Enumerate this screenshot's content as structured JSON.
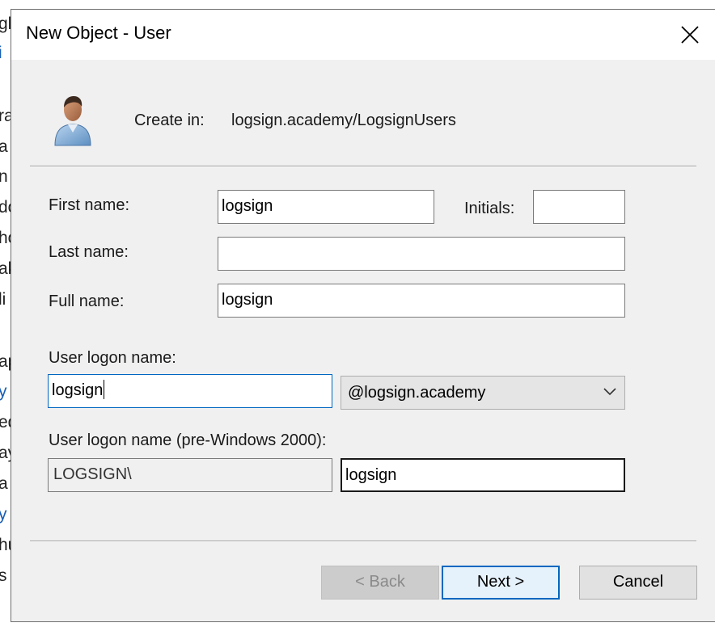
{
  "background_window": {
    "fragments": [
      "gl",
      "i",
      "ra",
      "a",
      "n",
      "do",
      "ho",
      "ak",
      "li",
      "ap",
      "y",
      "ed",
      "ay",
      "a",
      "y",
      "hu",
      "s"
    ]
  },
  "dialog": {
    "title": "New Object - User",
    "create_in_label": "Create in:",
    "create_in_path": "logsign.academy/LogsignUsers"
  },
  "form": {
    "first_name_label": "First name:",
    "first_name_value": "logsign",
    "initials_label": "Initials:",
    "initials_value": "",
    "last_name_label": "Last name:",
    "last_name_value": "",
    "full_name_label": "Full name:",
    "full_name_value": "logsign",
    "logon_name_label": "User logon name:",
    "logon_name_value": "logsign",
    "domain_suffix_selected": "@logsign.academy",
    "pre2000_label": "User logon name (pre-Windows 2000):",
    "pre2000_domain": "LOGSIGN\\",
    "pre2000_name": "logsign"
  },
  "buttons": {
    "back": "< Back",
    "next": "Next >",
    "cancel": "Cancel"
  },
  "colors": {
    "dialog_bg": "#f0f0f0",
    "focus_accent": "#0067c0"
  }
}
